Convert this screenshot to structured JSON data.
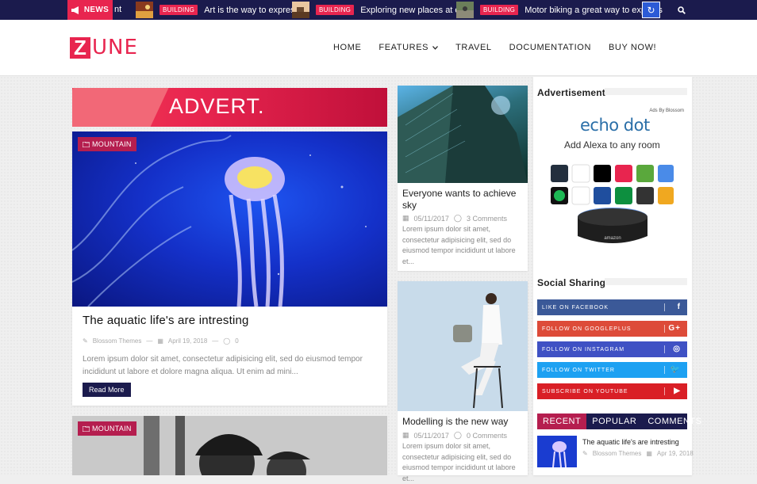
{
  "ticker": {
    "badge": "NEWS",
    "cut_text": "nt",
    "items": [
      {
        "tag": "BUILDING",
        "text": "Art is the way to express it"
      },
      {
        "tag": "BUILDING",
        "text": "Exploring new places at own"
      },
      {
        "tag": "BUILDING",
        "text": "Motor biking a great way to express"
      }
    ]
  },
  "header": {
    "logo_z": "Z",
    "logo_rest": "UNE",
    "nav": [
      {
        "label": "HOME"
      },
      {
        "label": "FEATURES"
      },
      {
        "label": "TRAVEL"
      },
      {
        "label": "DOCUMENTATION"
      },
      {
        "label": "BUY NOW!"
      }
    ]
  },
  "advert": {
    "text": "ADVERT."
  },
  "main_post": {
    "category": "MOUNTAIN",
    "title": "The aquatic life's are intresting",
    "author": "Blossom Themes",
    "date": "April 19, 2018",
    "comments": "0",
    "excerpt": "Lorem ipsum dolor sit amet, consectetur adipisicing elit, sed do eiusmod tempor incididunt ut labore et dolore magna aliqua. Ut enim ad mini...",
    "read_more": "Read More"
  },
  "second_post": {
    "category": "MOUNTAIN"
  },
  "mid_posts": [
    {
      "title": "Everyone wants to achieve sky",
      "date": "05/11/2017",
      "comments": "3 Comments",
      "excerpt": "Lorem ipsum dolor sit amet, consectetur adipisicing elit, sed do eiusmod tempor incididunt ut labore et..."
    },
    {
      "title": "Modelling is the new way",
      "date": "05/11/2017",
      "comments": "0 Comments",
      "excerpt": "Lorem ipsum dolor sit amet, consectetur adipisicing elit, sed do eiusmod tempor incididunt ut labore et..."
    }
  ],
  "sidebar": {
    "advertisement_title": "Advertisement",
    "ad": {
      "by_label": "Ads By Blossom",
      "product": "echo dot",
      "tagline": "Add Alexa to any room",
      "device_brand": "amazon"
    },
    "social_title": "Social Sharing",
    "social": [
      {
        "label": "LIKE ON FACEBOOK",
        "icon": "f",
        "color": "#3b5998"
      },
      {
        "label": "FOLLOW ON GOOGLEPLUS",
        "icon": "G+",
        "color": "#dd4b39"
      },
      {
        "label": "FOLLOW ON INSTAGRAM",
        "icon": "◎",
        "color": "#3f51c4"
      },
      {
        "label": "FOLLOW ON TWITTER",
        "icon": "🐦",
        "color": "#1da1f2"
      },
      {
        "label": "SUBSCRIBE ON YOUTUBE",
        "icon": "▶",
        "color": "#d91f26"
      }
    ],
    "tabs": [
      "RECENT",
      "POPULAR",
      "COMMENTS"
    ],
    "recent": {
      "title": "The aquatic life's are intresting",
      "author": "Blossom Themes",
      "date": "Apr 19, 2018"
    }
  },
  "colors": {
    "accent": "#e8254f",
    "navy": "#1b1b4d",
    "tag": "#b51e4f"
  }
}
